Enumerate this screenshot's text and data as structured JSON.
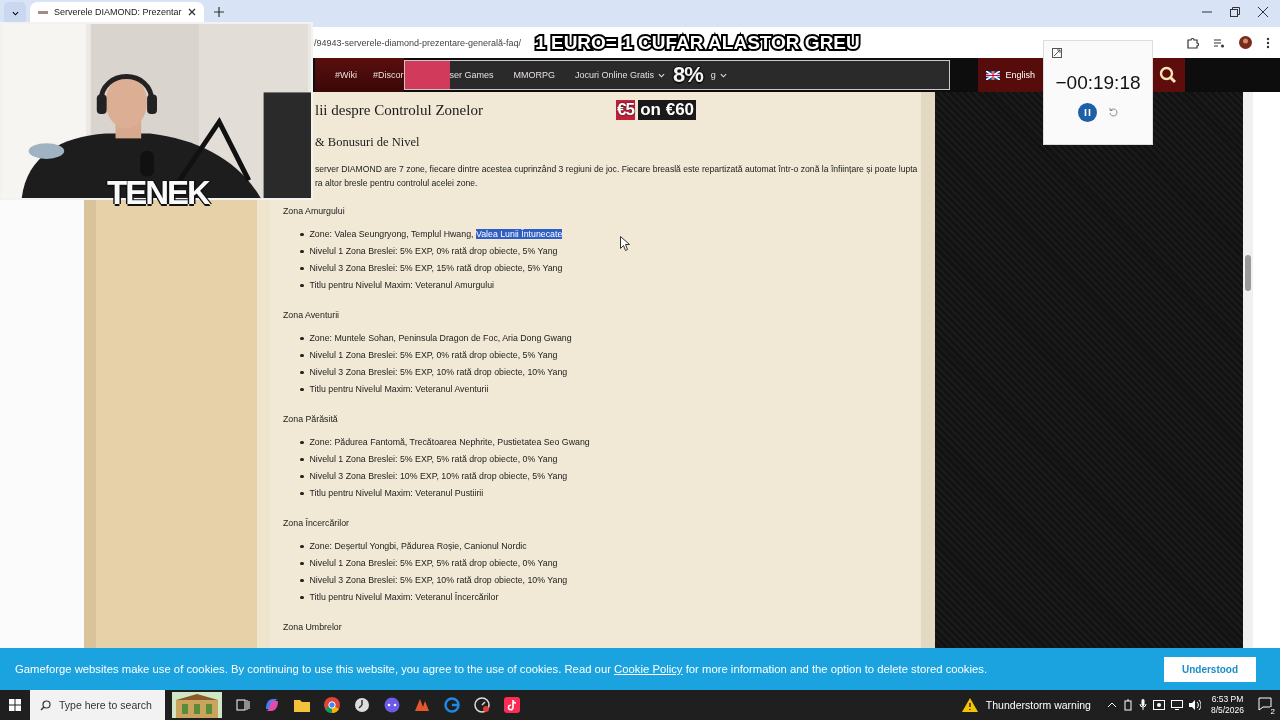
{
  "browser": {
    "tab_title": "Serverele DIAMOND: Prezentar",
    "url": "/94943-serverele-diamond-prezentare-generală-faq/"
  },
  "stream_overlay": {
    "headline": "1 EURO= 1 CUFAR ALASTOR GREU",
    "percent": "8%",
    "promo_badge": "€5",
    "promo_text": "on €60",
    "streamer": "TENEK"
  },
  "timer": {
    "time": "−00:19:18"
  },
  "nav": {
    "items": [
      {
        "label": "#Wiki",
        "dropdown": false
      },
      {
        "label": "#Discor",
        "dropdown": false
      }
    ],
    "framed_items": [
      {
        "label": "ser Games",
        "dropdown": false
      },
      {
        "label": "MMORPG",
        "dropdown": false
      },
      {
        "label": "Jocuri Online Gratis",
        "dropdown": true
      }
    ],
    "trailing_item": {
      "label": "g",
      "dropdown": true
    },
    "language": "English"
  },
  "article": {
    "heading": "lii despre Controlul Zonelor",
    "subheading": "& Bonusuri de Nivel",
    "paragraph_lines": [
      "server DIAMOND are 7 zone, fiecare dintre acestea cuprinzând 3 regiuni de joc. Fiecare breaslă este repartizată automat într-o zonă la înființare și poate lupta",
      "ra altor bresle pentru controlul acelei zone."
    ],
    "zones": [
      {
        "title": "Zona Amurgului",
        "items": [
          {
            "text": "Zone: Valea Seungryong, Templul Hwang,",
            "selected_text": "Valea Lunii Întunecate"
          },
          {
            "text": "Nivelul 1 Zona Breslei: 5% EXP, 0% rată drop obiecte, 5% Yang"
          },
          {
            "text": "Nivelul 3 Zona Breslei: 5% EXP, 15% rată drop obiecte, 5% Yang"
          },
          {
            "text": "Titlu pentru Nivelul Maxim: Veteranul Amurgului"
          }
        ]
      },
      {
        "title": "Zona Aventurii",
        "items": [
          {
            "text": "Zone: Muntele Sohan, Peninsula Dragon de Foc, Aria Dong Gwang"
          },
          {
            "text": "Nivelul 1 Zona Breslei: 5% EXP, 0% rată drop obiecte, 5% Yang"
          },
          {
            "text": "Nivelul 3 Zona Breslei: 5% EXP, 10% rată drop obiecte, 10% Yang"
          },
          {
            "text": "Titlu pentru Nivelul Maxim: Veteranul Aventurii"
          }
        ]
      },
      {
        "title": "Zona Părăsită",
        "items": [
          {
            "text": "Zone: Pădurea Fantomă, Trecătoarea Nephrite, Pustietatea Seo Gwang"
          },
          {
            "text": "Nivelul 1 Zona Breslei: 5% EXP, 5% rată drop obiecte, 0% Yang"
          },
          {
            "text": "Nivelul 3 Zona Breslei: 10% EXP, 10% rată drop obiecte, 5% Yang"
          },
          {
            "text": "Titlu pentru Nivelul Maxim: Veteranul Pustiirii"
          }
        ]
      },
      {
        "title": "Zona Încercărilor",
        "items": [
          {
            "text": "Zone: Deșertul Yongbi, Pădurea Roșie, Canionul Nordic"
          },
          {
            "text": "Nivelul 1 Zona Breslei: 5% EXP, 5% rată drop obiecte, 0% Yang"
          },
          {
            "text": "Nivelul 3 Zona Breslei: 5% EXP, 10% rată drop obiecte, 10% Yang"
          },
          {
            "text": "Titlu pentru Nivelul Maxim: Veteranul Încercărilor"
          }
        ]
      },
      {
        "title": "Zona Umbrelor"
      }
    ]
  },
  "cookie_banner": {
    "text_before": "Gameforge websites make use of cookies. By continuing to use this website, you agree to the use of cookies. Read our",
    "link": "Cookie Policy",
    "text_after": "for more information and the option to delete stored cookies.",
    "button": "Understood"
  },
  "taskbar": {
    "search_placeholder": "Type here to search",
    "weather": "Thunderstorm warning",
    "time": "6:53 PM",
    "date": "8/5/2026",
    "notifications": "2"
  }
}
